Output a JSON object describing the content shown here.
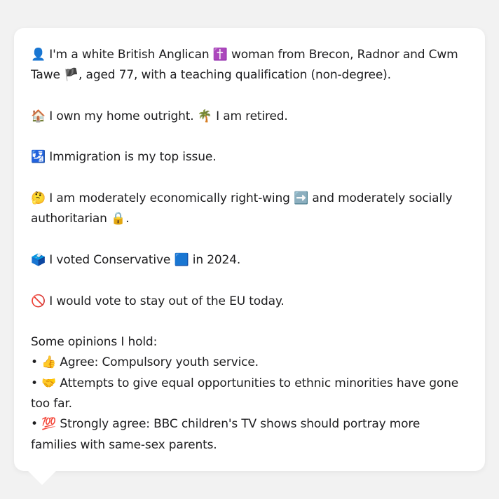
{
  "persona": {
    "intro_emoji": "👤",
    "intro_a": " I'm a white British Anglican ",
    "faith_emoji": "✝️",
    "intro_b": " woman from Brecon, Radnor and Cwm Tawe ",
    "flag_emoji": "🏴",
    "intro_c": ", aged 77, with a teaching qualification (non-degree).",
    "home_emoji": "🏠",
    "home_a": " I own my home outright. ",
    "retired_emoji": "🌴",
    "home_b": " I am retired.",
    "issue_emoji": "🛂",
    "issue_text": " Immigration is my top issue.",
    "think_emoji": "🤔",
    "econ_a": " I am moderately economically right-wing ",
    "arrow_emoji": "➡️",
    "econ_b": " and moderately socially authoritarian ",
    "lock_emoji": "🔒",
    "econ_c": ".",
    "ballot_emoji": "🗳️",
    "vote_a": " I voted Conservative ",
    "party_emoji": "🟦",
    "vote_b": " in 2024.",
    "no_emoji": "🚫",
    "eu_text": " I would vote to stay out of the EU today.",
    "opinions_heading": "Some opinions I hold:",
    "opinions": [
      {
        "bullet": "• ",
        "emoji": "👍",
        "text": " Agree: Compulsory youth service."
      },
      {
        "bullet": "• ",
        "emoji": "🤝",
        "text": " Attempts to give equal opportunities to ethnic minorities have gone too far."
      },
      {
        "bullet": "• ",
        "emoji": "💯",
        "text": " Strongly agree: BBC children's TV shows should portray more families with same-sex parents."
      }
    ]
  }
}
